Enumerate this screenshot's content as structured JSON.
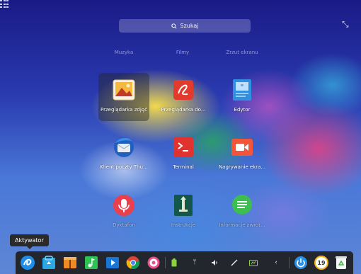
{
  "search": {
    "placeholder": "Szukaj"
  },
  "categories": [
    "Muzyka",
    "Filmy",
    "Zrzut ekranu"
  ],
  "apps": [
    {
      "label": "Przeglądarka zdjęć",
      "icon": "image-viewer-icon",
      "selected": true,
      "dim": false
    },
    {
      "label": "Przeglądarka do...",
      "icon": "document-viewer-icon",
      "selected": false,
      "dim": false
    },
    {
      "label": "Edytor",
      "icon": "text-editor-icon",
      "selected": false,
      "dim": false
    },
    {
      "label": "Klient poczty Thu...",
      "icon": "thunderbird-icon",
      "selected": false,
      "dim": false
    },
    {
      "label": "Terminal",
      "icon": "terminal-icon",
      "selected": false,
      "dim": false
    },
    {
      "label": "Nagrywanie ekra...",
      "icon": "screen-recorder-icon",
      "selected": false,
      "dim": false
    },
    {
      "label": "Dyktafon",
      "icon": "voice-recorder-icon",
      "selected": false,
      "dim": true
    },
    {
      "label": "Instrukcje",
      "icon": "manual-icon",
      "selected": false,
      "dim": true
    },
    {
      "label": "Informacje zwrot...",
      "icon": "feedback-icon",
      "selected": false,
      "dim": true
    }
  ],
  "tooltip": {
    "text": "Aktywator"
  },
  "dock": {
    "launchers": [
      "launcher-icon",
      "app-store-icon",
      "archive-manager-icon",
      "music-icon",
      "video-player-icon",
      "chrome-icon",
      "settings-icon"
    ],
    "tray": [
      "battery-icon",
      "usb-icon",
      "volume-icon",
      "pen-icon",
      "network-icon",
      "collapse-tray-icon"
    ],
    "right": [
      "power-icon",
      "calendar-icon",
      "trash-icon"
    ],
    "calendar_day": "19"
  }
}
